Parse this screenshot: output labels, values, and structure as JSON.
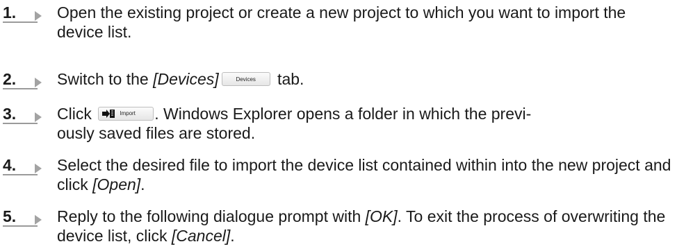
{
  "steps": [
    {
      "number": "1.",
      "text": "Open the existing project or create a new project to which you want to import the device list."
    },
    {
      "number": "2.",
      "before": "Switch to the ",
      "italic": "[Devices]",
      "button_label": "Devices",
      "after": " tab."
    },
    {
      "number": "3.",
      "before": "Click ",
      "button_label": "Import",
      "button_icon": "import-icon",
      "after": ". Windows Explorer opens a folder in which the previ-ously saved files are stored.",
      "after_line1": ". Windows Explorer opens a folder in which the previ-",
      "after_line2": "ously saved files are stored."
    },
    {
      "number": "4.",
      "before": "Select the desired file to import the device list contained within into the new project and click ",
      "italic": "[Open]",
      "after": "."
    },
    {
      "number": "5.",
      "before": "Reply to the following dialogue prompt with ",
      "italic1": "[OK]",
      "middle": ". To exit the process of overwriting the device list, click ",
      "italic2": "[Cancel]",
      "after": "."
    }
  ]
}
